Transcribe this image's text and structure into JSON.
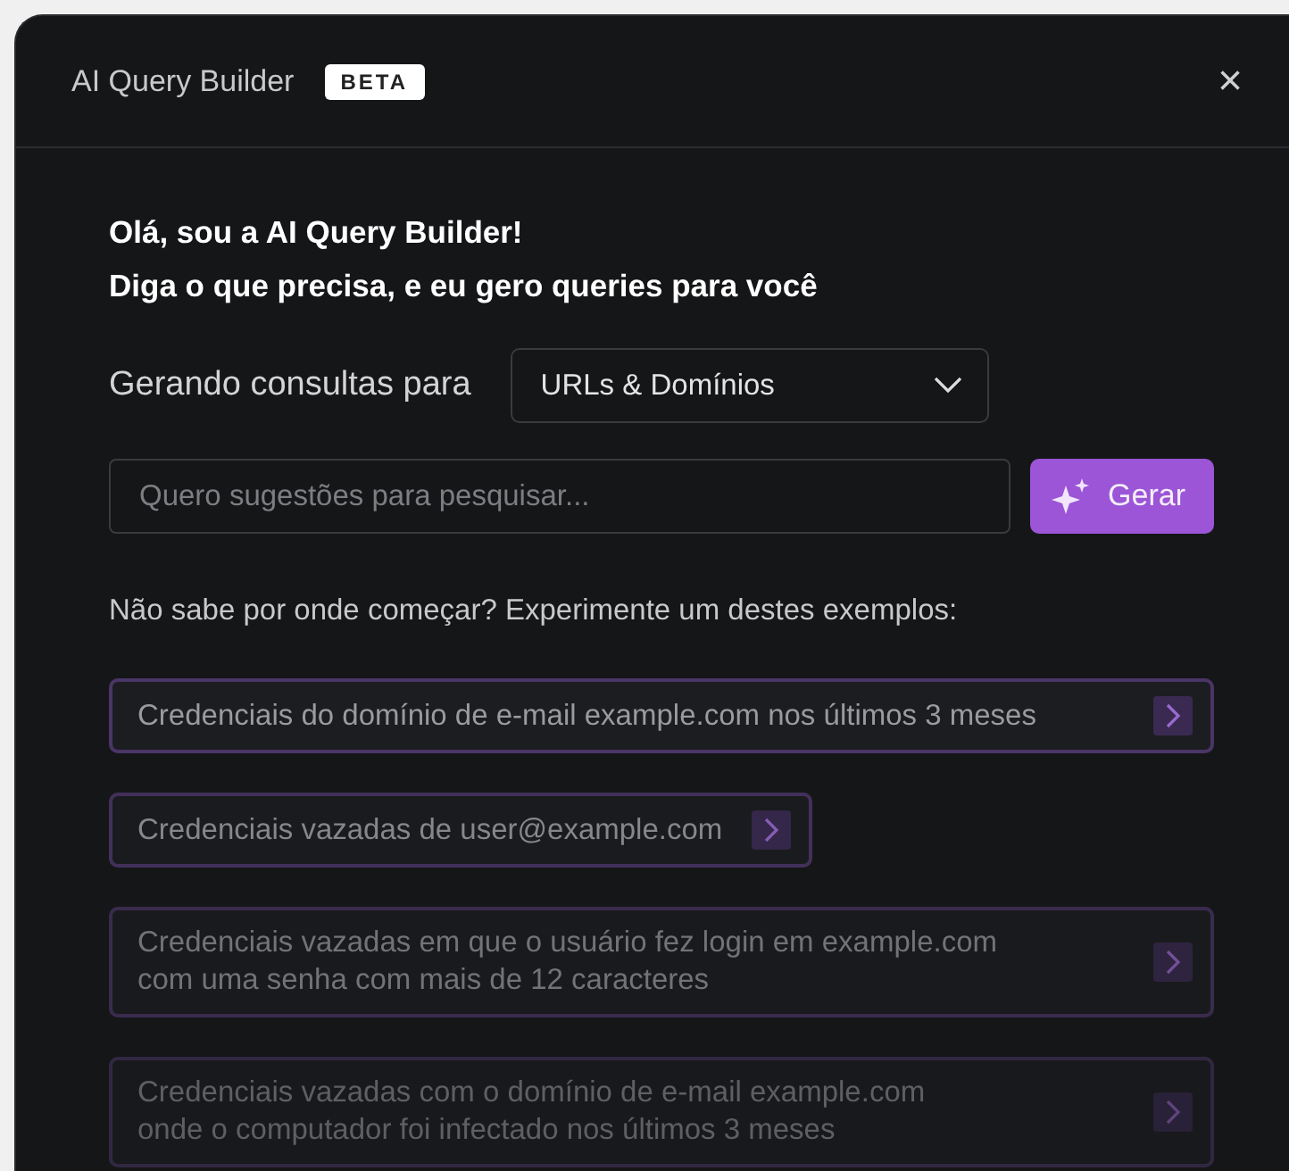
{
  "dialog": {
    "title": "AI Query Builder",
    "badge": "BETA",
    "close": "×"
  },
  "greeting": [
    "Olá, sou a AI Query Builder!",
    "Diga o que precisa, e eu gero queries para você"
  ],
  "scope": {
    "label": "Gerando consultas para",
    "value": "URLs & Domínios"
  },
  "prompt": {
    "placeholder": "Quero sugestões para pesquisar...",
    "button": "Gerar"
  },
  "examples_intro": "Não sabe por onde começar? Experimente um destes exemplos:",
  "examples": [
    {
      "lines": [
        "Credenciais do domínio de e-mail example.com nos últimos 3 meses"
      ]
    },
    {
      "lines": [
        "Credenciais vazadas de user@example.com"
      ]
    },
    {
      "lines": [
        "Credenciais vazadas em que o usuário fez login em example.com",
        "com uma senha com mais de 12 caracteres"
      ]
    },
    {
      "lines": [
        "Credenciais vazadas com o domínio de e-mail example.com",
        "onde o computador foi infectado nos últimos 3 meses"
      ]
    }
  ]
}
